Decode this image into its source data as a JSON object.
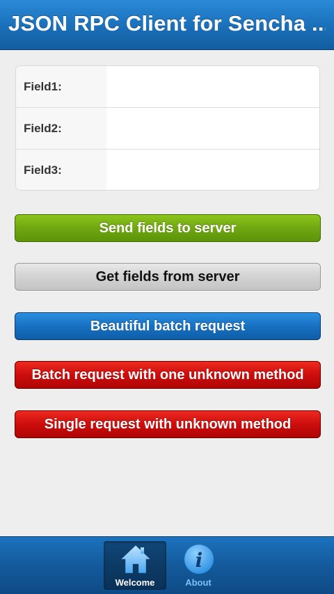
{
  "header": {
    "title": "JSON RPC Client for Sencha ..."
  },
  "form": {
    "fields": [
      {
        "label": "Field1:",
        "value": ""
      },
      {
        "label": "Field2:",
        "value": ""
      },
      {
        "label": "Field3:",
        "value": ""
      }
    ]
  },
  "buttons": {
    "send": "Send fields to server",
    "get": "Get fields from server",
    "batch": "Beautiful batch request",
    "batch_unknown": "Batch request with one unknown method",
    "single_unknown": "Single request with unknown method"
  },
  "tabbar": {
    "tabs": [
      {
        "label": "Welcome",
        "icon": "home-icon",
        "active": true
      },
      {
        "label": "About",
        "icon": "info-icon",
        "active": false
      }
    ]
  },
  "colors": {
    "header": "#1a6fb8",
    "green": "#70a711",
    "blue": "#1870c0",
    "red": "#cc0d0d",
    "gray": "#d2d2d2"
  }
}
